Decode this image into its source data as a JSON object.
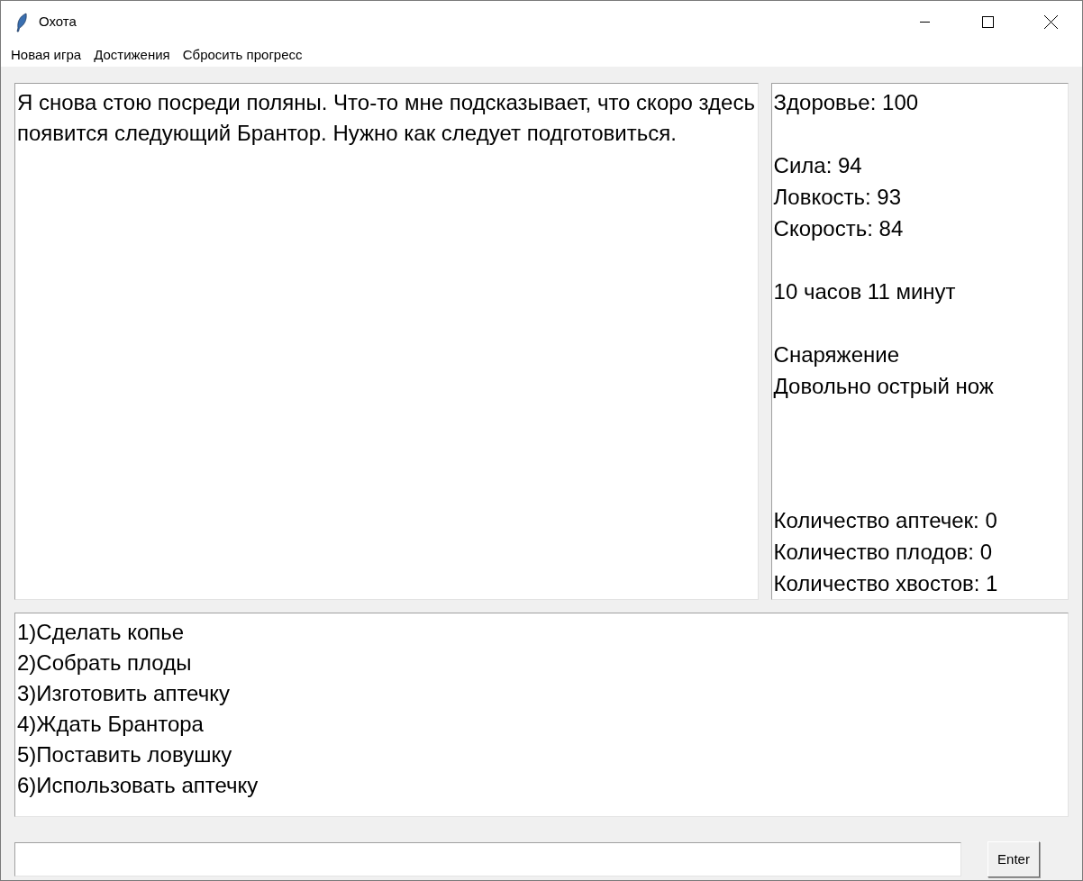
{
  "window": {
    "title": "Охота"
  },
  "menu": [
    "Новая игра",
    "Достижения",
    "Сбросить прогресс"
  ],
  "story": "Я снова стою посреди поляны. Что-то мне подсказывает, что скоро здесь появится следующий Брантор. Нужно как следует подготовиться.",
  "stats": [
    {
      "lines": [
        "Здоровье: 100"
      ]
    },
    {
      "lines": [
        "Сила: 94",
        "Ловкость: 93",
        "Скорость: 84"
      ]
    },
    {
      "lines": [
        "10 часов 11 минут"
      ]
    },
    {
      "lines": [
        "Снаряжение",
        "Довольно острый нож"
      ]
    }
  ],
  "counts": [
    "Количество аптечек: 0",
    "Количество плодов: 0",
    "Количество хвостов: 1"
  ],
  "options": [
    "1)Сделать копье",
    "2)Собрать плоды",
    "3)Изготовить аптечку",
    "4)Ждать Брантора",
    "5)Поставить ловушку",
    "6)Использовать аптечку"
  ],
  "command": {
    "button": "Enter"
  }
}
